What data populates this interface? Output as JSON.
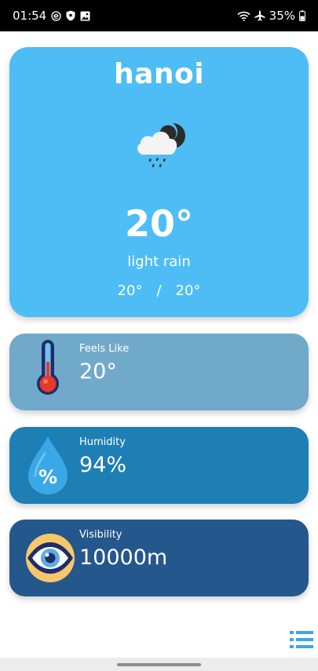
{
  "status_bar": {
    "time": "01:54",
    "battery": "35%"
  },
  "weather": {
    "city": "hanoi",
    "icon": "cloud-rain-night-icon",
    "temperature": "20°",
    "description": "light rain",
    "temp_low": "20°",
    "separator": "/",
    "temp_high": "20°"
  },
  "cards": {
    "feels_like": {
      "label": "Feels Like",
      "value": "20°",
      "icon": "thermometer-icon",
      "color": "#71a9cb"
    },
    "humidity": {
      "label": "Humidity",
      "value": "94%",
      "icon": "humidity-drop-icon",
      "icon_text": "%",
      "color": "#1e7fb5"
    },
    "visibility": {
      "label": "Visibility",
      "value": "10000m",
      "icon": "eye-icon",
      "color": "#24578c"
    }
  },
  "colors": {
    "main_card": "#4ebdf5",
    "accent": "#3aa7e6"
  }
}
